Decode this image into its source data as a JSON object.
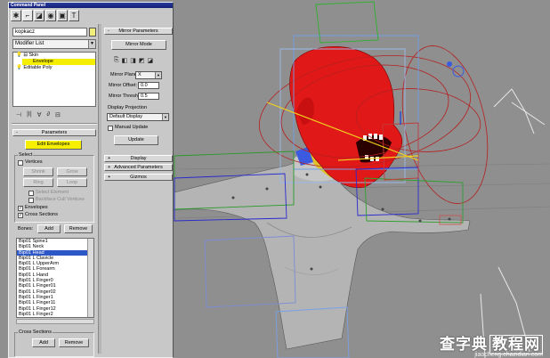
{
  "window": {
    "title": "Command Panel"
  },
  "tabs": [
    {
      "icon": "create-icon",
      "glyph": "✱"
    },
    {
      "icon": "modify-icon",
      "glyph": "⌐"
    },
    {
      "icon": "hierarchy-icon",
      "glyph": "◪"
    },
    {
      "icon": "motion-icon",
      "glyph": "◉"
    },
    {
      "icon": "display-icon",
      "glyph": "▣"
    },
    {
      "icon": "utilities-icon",
      "glyph": "T"
    }
  ],
  "object": {
    "name": "kopkacz",
    "color": "#f1ee7c"
  },
  "modifier_list": {
    "label": "Modifier List"
  },
  "stack": {
    "items": [
      "Skin",
      "Envelope",
      "Editable Poly"
    ]
  },
  "stack_tools": [
    "⊣",
    "|I|",
    "∀",
    "∂",
    "⊟"
  ],
  "parameters": {
    "header": "Parameters",
    "edit_envelopes": "Edit Envelopes",
    "select_group": "Select",
    "vertices": "Vertices",
    "shrink": "Shrink",
    "grow": "Grow",
    "ring": "Ring",
    "loop": "Loop",
    "select_element": "Select Element",
    "backface_cull": "Backface Cull Vertices",
    "envelopes": "Envelopes",
    "cross_sections": "Cross Sections",
    "bones_label": "Bones:",
    "add": "Add",
    "remove": "Remove",
    "bones": [
      "Bip01 Spine1",
      "Bip01 Neck",
      "Bip01 Head",
      "Bip01 L Clavicle",
      "Bip01 L UpperArm",
      "Bip01 L Forearm",
      "Bip01 L Hand",
      "Bip01 L Finger0",
      "Bip01 L Finger01",
      "Bip01 L Finger02",
      "Bip01 L Finger1",
      "Bip01 L Finger11",
      "Bip01 L Finger12",
      "Bip01 L Finger2"
    ],
    "selected_bone": "Bip01 Head",
    "cross_sections_group": "Cross Sections",
    "cs_add": "Add",
    "cs_remove": "Remove"
  },
  "mirror": {
    "header": "Mirror Parameters",
    "mirror_mode": "Mirror Mode",
    "mirror_plane_label": "Mirror Plane:",
    "mirror_plane": "X",
    "mirror_offset_label": "Mirror Offset:",
    "mirror_offset": "0.0",
    "mirror_thresh_label": "Mirror Thresh.:",
    "mirror_thresh": "0.5",
    "display_projection_label": "Display Projection",
    "display_projection": "Default Display",
    "manual_update": "Manual Update",
    "update": "Update"
  },
  "rollouts": [
    "Display",
    "Advanced Parameters",
    "Gizmos"
  ],
  "watermark": {
    "line1": "查字典",
    "line2": "教程网",
    "url": "jiaocheng.chazidian.com"
  }
}
